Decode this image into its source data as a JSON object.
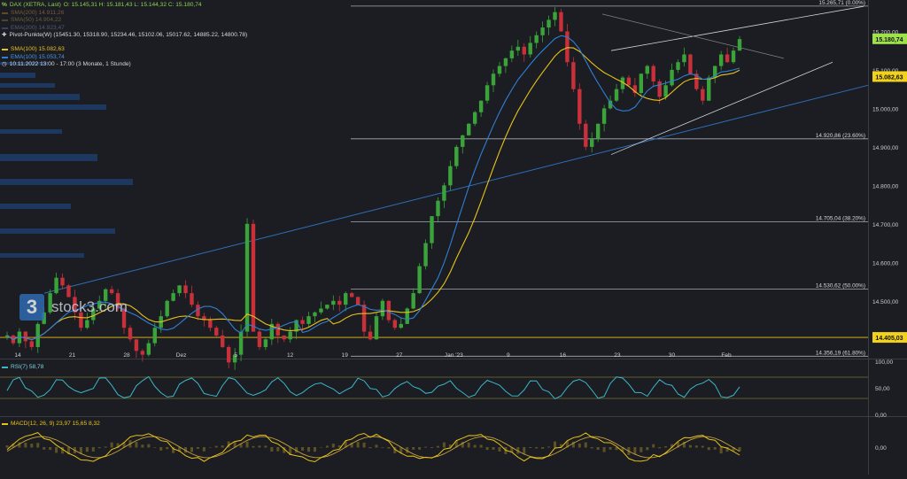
{
  "header": {
    "instrument": "DAX (XETRA, Last)",
    "ohlc": "O: 15.145,31   H: 15.181,43   L: 15.144,32   C: 15.180,74",
    "sma200": "SMA(200)  14.911,26",
    "sma50": "SMA(50)  14.904,22",
    "ema200": "EMA(200)  14.923,47",
    "pivot": "Pivot-Punkte(W)  (15451.30,  15318.90,  15234.46,  15102.06,  15017.62,  14885.22,  14800.78)",
    "sma100": "SMA(100)  15.082,63",
    "ema100": "EMA(100)  15.053,74",
    "timeframe": "10.11.2022 13:00 - 17:00   (3 Monate, 1 Stunde)"
  },
  "logo": {
    "mark": "3",
    "text": "stock3.com"
  },
  "colors": {
    "up": "#3aa43a",
    "down": "#c8303a",
    "sma100": "#e8c21a",
    "ema100": "#2f7fd6",
    "rsi": "#3bb7c9",
    "macd": "#e8c21a",
    "signal": "#c7a23b",
    "fib": "#a8acb2",
    "last_price_tag": "#9ee24a",
    "sma_tag": "#f2d21b",
    "level_tag": "#f2d21b"
  },
  "price_tags": {
    "last": "15.180,74",
    "sma": "15.082,63",
    "level": "14.405,03"
  },
  "rsi_label": "RSI(7)  58,78",
  "macd_label": "MACD(12, 26, 9)  23,97  15,65  8,32",
  "chart_data": {
    "type": "candlestick",
    "title": "DAX (XETRA, Last)",
    "timeframe": "1 hour, 3 months",
    "y_ticks": [
      "15.200,00",
      "15.100,00",
      "15.000,00",
      "14.900,00",
      "14.800,00",
      "14.700,00",
      "14.600,00",
      "14.500,00"
    ],
    "x_ticks": [
      "14",
      "21",
      "28",
      "Dez",
      "5",
      "12",
      "19",
      "27",
      "Jan '23",
      "9",
      "16",
      "23",
      "30",
      "Feb"
    ],
    "ylim": [
      14350,
      15270
    ],
    "fib_levels": [
      {
        "value": 15265.71,
        "label": "15.265,71 (0.00%)"
      },
      {
        "value": 14920.86,
        "label": "14.920,86 (23.60%)"
      },
      {
        "value": 14705.04,
        "label": "14.705,04 (38.20%)"
      },
      {
        "value": 14530.62,
        "label": "14.530,62 (50.00%)"
      },
      {
        "value": 14356.19,
        "label": "14.356,19 (61.80%)"
      }
    ],
    "horizontal_levels": [
      14405.03
    ],
    "last_close": 15180.74,
    "sma100_last": 15082.63,
    "ema100_last": 15053.74,
    "close_path": [
      14410,
      14390,
      14420,
      14395,
      14380,
      14440,
      14470,
      14520,
      14560,
      14540,
      14510,
      14470,
      14430,
      14450,
      14480,
      14500,
      14530,
      14520,
      14480,
      14430,
      14400,
      14370,
      14360,
      14390,
      14430,
      14460,
      14500,
      14520,
      14540,
      14520,
      14490,
      14460,
      14450,
      14430,
      14410,
      14380,
      14340,
      14360,
      14420,
      14700,
      14420,
      14380,
      14400,
      14440,
      14410,
      14400,
      14420,
      14450,
      14440,
      14460,
      14470,
      14480,
      14490,
      14500,
      14490,
      14520,
      14510,
      14490,
      14420,
      14400,
      14460,
      14500,
      14450,
      14430,
      14440,
      14480,
      14520,
      14590,
      14650,
      14720,
      14760,
      14800,
      14850,
      14900,
      14930,
      14960,
      14990,
      15020,
      15060,
      15090,
      15110,
      15130,
      15150,
      15160,
      15140,
      15170,
      15190,
      15210,
      15230,
      15250,
      15200,
      15120,
      15050,
      14960,
      14900,
      14920,
      14960,
      15000,
      15020,
      15050,
      15080,
      15060,
      15040,
      15090,
      15110,
      15070,
      15030,
      15060,
      15100,
      15120,
      15140,
      15090,
      15050,
      15020,
      15080,
      15110,
      15140,
      15120,
      15150,
      15180
    ],
    "rsi": {
      "name": "RSI(7)",
      "last": 58.78,
      "levels": [
        70,
        30
      ],
      "y_ticks": [
        "100,00",
        "50,00",
        "0,00"
      ]
    },
    "macd": {
      "name": "MACD(12, 26, 9)",
      "values": [
        23.97,
        15.65,
        8.32
      ],
      "y_ticks": [
        "0,00"
      ]
    }
  }
}
